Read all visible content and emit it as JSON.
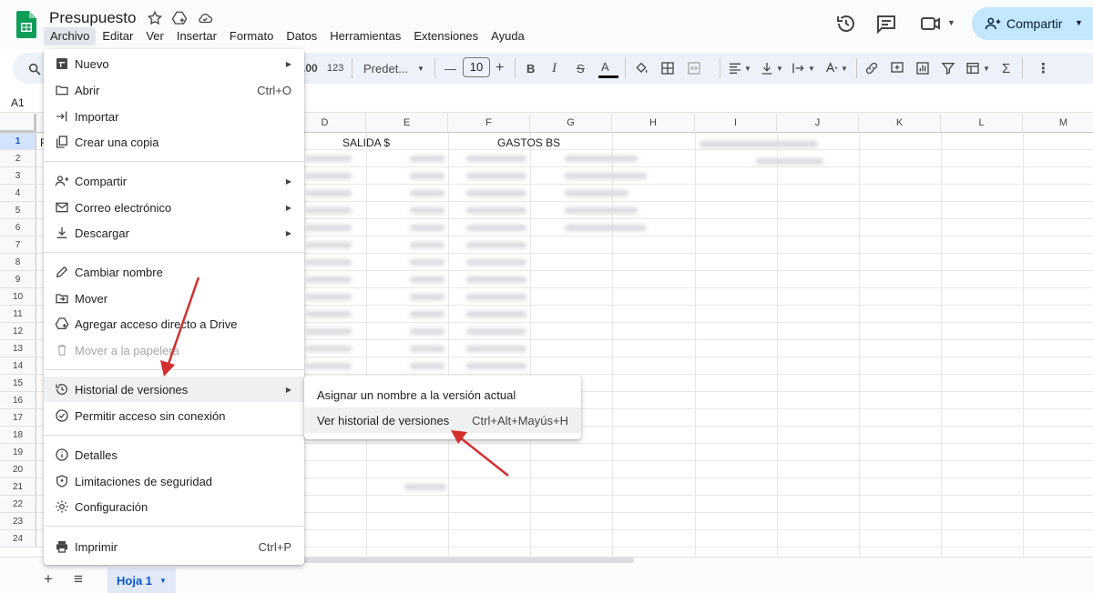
{
  "header": {
    "doc_title": "Presupuesto",
    "menus": [
      "Archivo",
      "Editar",
      "Ver",
      "Insertar",
      "Formato",
      "Datos",
      "Herramientas",
      "Extensiones",
      "Ayuda"
    ],
    "share_label": "Compartir"
  },
  "toolbar": {
    "number_format": "123",
    "decimal_label": ".00",
    "font_family": "Predet...",
    "font_size": "10",
    "minus": "—",
    "plus": "+",
    "bold": "B",
    "italic": "I",
    "strike": "S",
    "text_color": "A",
    "sum": "Σ",
    "more": "⋮"
  },
  "formula_bar": {
    "cell_ref": "A1"
  },
  "grid": {
    "columns": [
      "D",
      "E",
      "F",
      "G",
      "H",
      "I",
      "J",
      "K",
      "L",
      "M"
    ],
    "rows": [
      "1",
      "2",
      "3",
      "4",
      "5",
      "6",
      "7",
      "8",
      "9",
      "10",
      "11",
      "12",
      "13",
      "14",
      "15",
      "16",
      "17",
      "18",
      "19",
      "20",
      "21",
      "22",
      "23",
      "24"
    ],
    "cells": {
      "d1_e1": "SALIDA $",
      "f1": "GASTOS BS",
      "a1_partial": "F"
    }
  },
  "sheet_tabs": {
    "add": "+",
    "list": "≡",
    "active": "Hoja 1"
  },
  "file_menu": {
    "items": [
      {
        "label": "Nuevo",
        "submenu": true
      },
      {
        "label": "Abrir",
        "shortcut": "Ctrl+O"
      },
      {
        "label": "Importar"
      },
      {
        "label": "Crear una copia"
      },
      {
        "label": "Compartir",
        "submenu": true
      },
      {
        "label": "Correo electrónico",
        "submenu": true
      },
      {
        "label": "Descargar",
        "submenu": true
      },
      {
        "label": "Cambiar nombre"
      },
      {
        "label": "Mover"
      },
      {
        "label": "Agregar acceso directo a Drive"
      },
      {
        "label": "Mover a la papelera",
        "disabled": true
      },
      {
        "label": "Historial de versiones",
        "submenu": true,
        "highlighted": true
      },
      {
        "label": "Permitir acceso sin conexión"
      },
      {
        "label": "Detalles"
      },
      {
        "label": "Limitaciones de seguridad"
      },
      {
        "label": "Configuración"
      },
      {
        "label": "Imprimir",
        "shortcut": "Ctrl+P"
      }
    ]
  },
  "version_submenu": {
    "items": [
      {
        "label": "Asignar un nombre a la versión actual"
      },
      {
        "label": "Ver historial de versiones",
        "shortcut": "Ctrl+Alt+Mayús+H",
        "highlighted": true
      }
    ]
  },
  "colors": {
    "accent": "#0b57d0",
    "share_bg": "#c2e7ff",
    "arrow": "#d32f2f",
    "sheets_green": "#0f9d58"
  }
}
